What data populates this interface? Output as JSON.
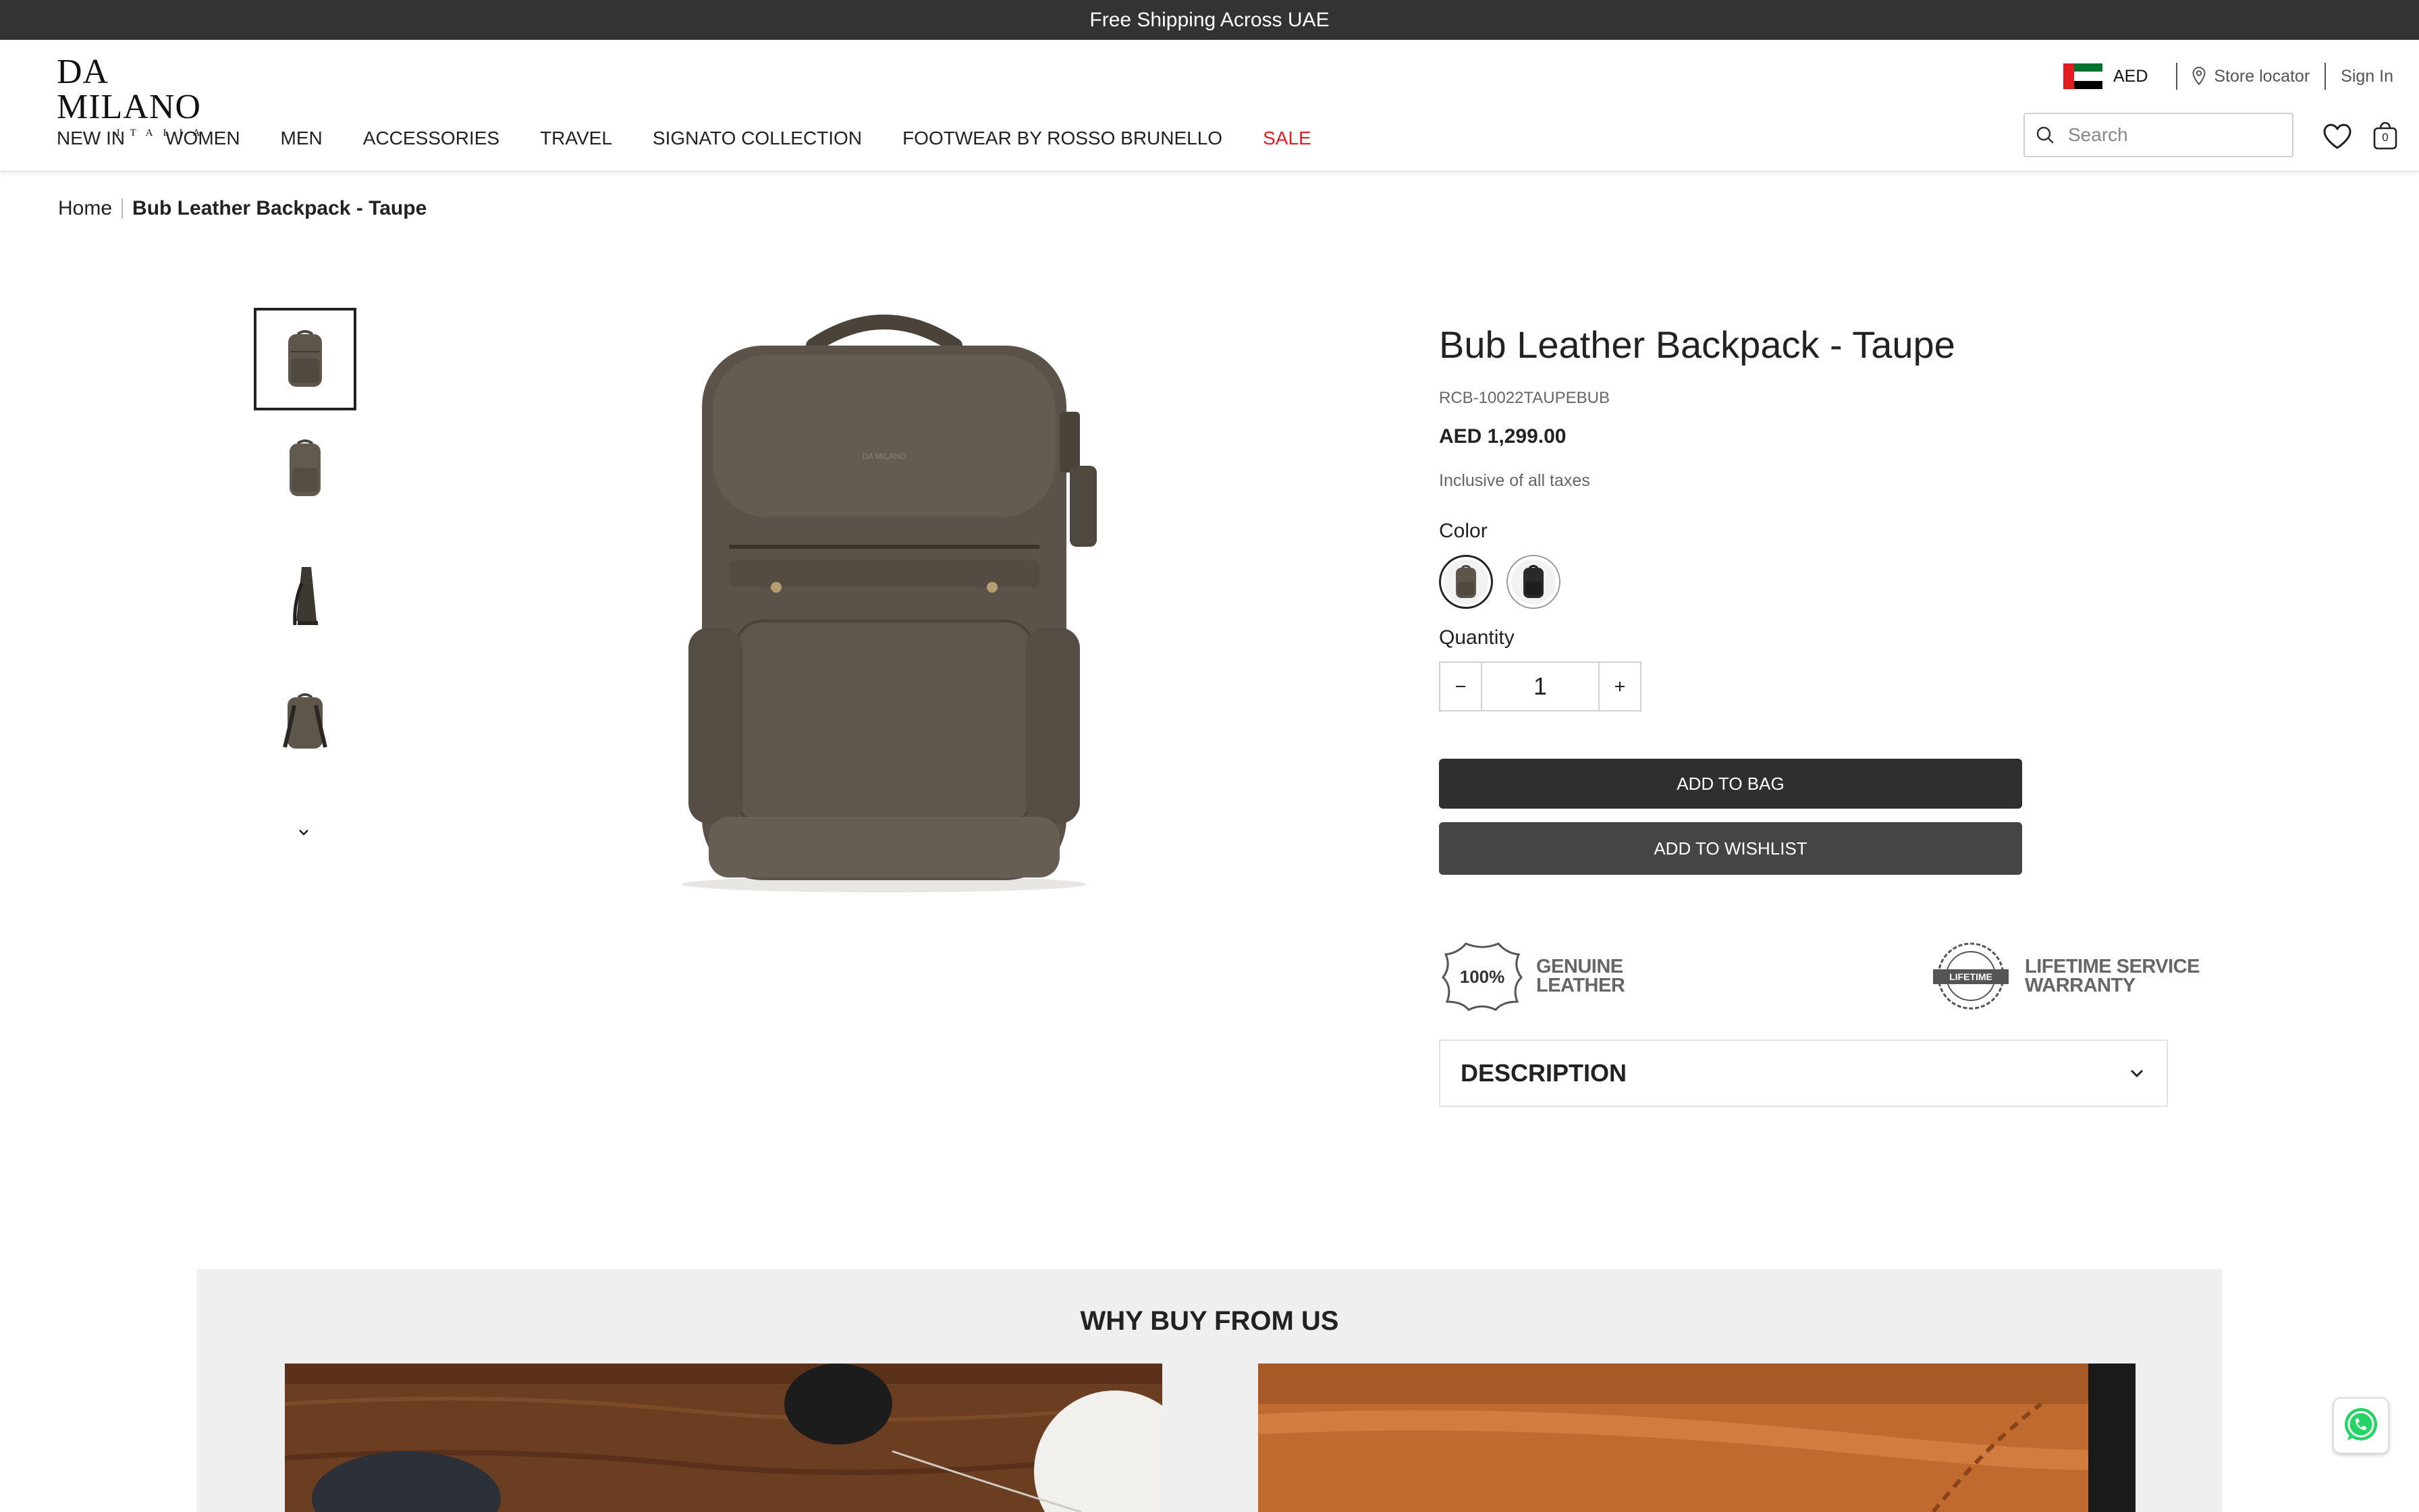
{
  "announcement": "Free Shipping Across UAE",
  "logo": {
    "main": "DA MILANO",
    "sub": "ITALIA"
  },
  "utility": {
    "currency": "AED",
    "store_locator": "Store locator",
    "sign_in": "Sign In",
    "flag_colors": [
      "#e21c21",
      "#00732f",
      "#ffffff",
      "#000000"
    ]
  },
  "nav": [
    "NEW IN",
    "WOMEN",
    "MEN",
    "ACCESSORIES",
    "TRAVEL",
    "SIGNATO COLLECTION",
    "FOOTWEAR BY ROSSO BRUNELLO",
    "SALE"
  ],
  "search": {
    "placeholder": "Search"
  },
  "cart": {
    "count": "0"
  },
  "breadcrumb": {
    "home": "Home",
    "current": "Bub Leather Backpack - Taupe"
  },
  "product": {
    "title": "Bub Leather Backpack - Taupe",
    "sku": "RCB-10022TAUPEBUB",
    "price": "AED 1,299.00",
    "tax_note": "Inclusive of all taxes",
    "color_label": "Color",
    "colors": [
      {
        "name": "taupe",
        "hex": "#5e564b",
        "selected": true
      },
      {
        "name": "black",
        "hex": "#2a2a2a",
        "selected": false
      }
    ],
    "quantity_label": "Quantity",
    "quantity": "1",
    "add_to_bag": "ADD TO BAG",
    "add_to_wishlist": "ADD TO WISHLIST",
    "badges": [
      {
        "icon": "100%",
        "line1": "GENUINE",
        "line2": "LEATHER"
      },
      {
        "icon": "LIFETIME",
        "line1": "LIFETIME SERVICE",
        "line2": "WARRANTY"
      }
    ],
    "description_label": "DESCRIPTION"
  },
  "why_buy": {
    "title": "WHY BUY FROM US"
  },
  "colors": {
    "announce_bg": "#333333",
    "sale": "#e31b23",
    "bag_button": "#2f2f2f",
    "wishlist_button": "#454545",
    "whatsapp": "#25d366"
  }
}
